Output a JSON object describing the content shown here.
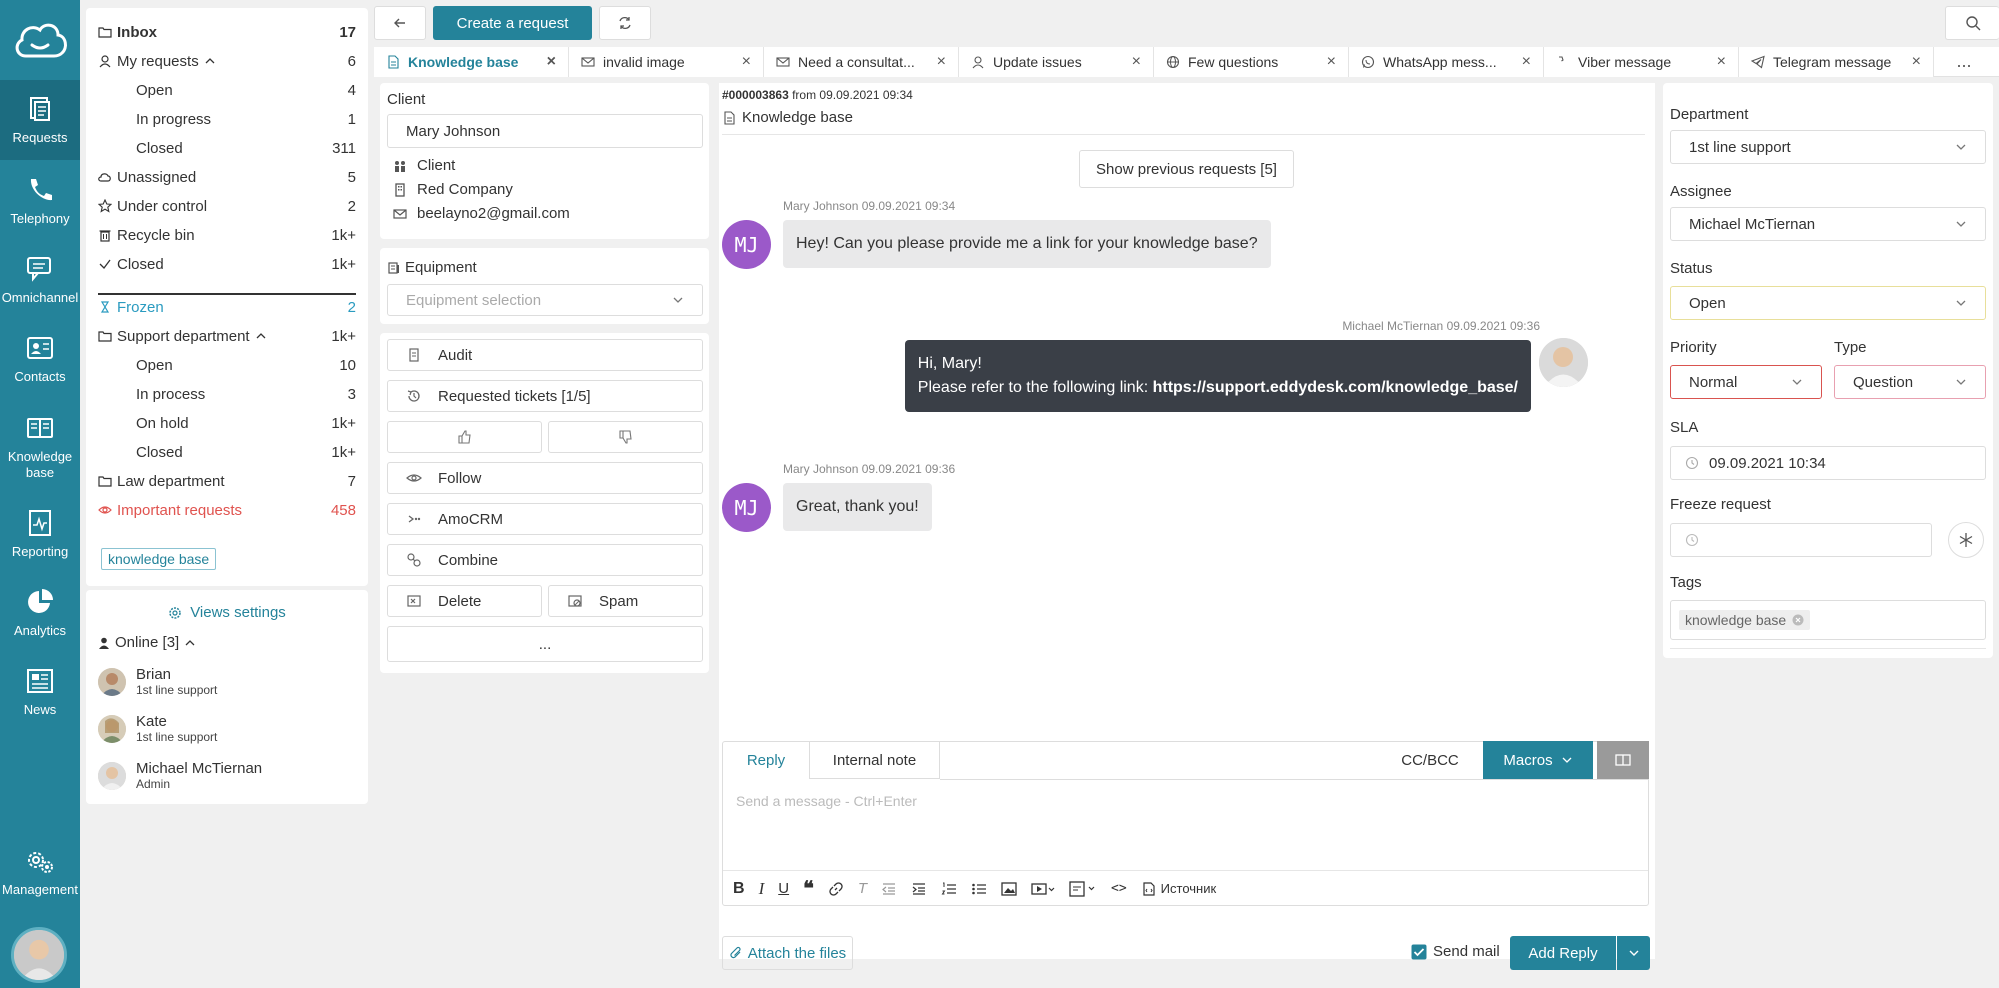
{
  "rail": {
    "items": [
      {
        "label": "Requests",
        "icon": "requests-icon"
      },
      {
        "label": "Telephony",
        "icon": "phone-icon"
      },
      {
        "label": "Omnichannel",
        "icon": "chat-icon"
      },
      {
        "label": "Contacts",
        "icon": "contacts-icon"
      },
      {
        "label": "Knowledge",
        "label2": "base",
        "icon": "book-icon"
      },
      {
        "label": "Reporting",
        "icon": "report-icon"
      },
      {
        "label": "Analytics",
        "icon": "pie-icon"
      },
      {
        "label": "News",
        "icon": "news-icon"
      },
      {
        "label": "Management",
        "icon": "gears-icon"
      }
    ]
  },
  "sidebar": {
    "inbox": {
      "label": "Inbox",
      "count": "17"
    },
    "my_requests": {
      "label": "My requests",
      "count": "6"
    },
    "open": {
      "label": "Open",
      "count": "4"
    },
    "in_progress": {
      "label": "In progress",
      "count": "1"
    },
    "closed": {
      "label": "Closed",
      "count": "311"
    },
    "unassigned": {
      "label": "Unassigned",
      "count": "5"
    },
    "under_control": {
      "label": "Under control",
      "count": "2"
    },
    "recycle": {
      "label": "Recycle bin",
      "count": "1k+"
    },
    "closed_all": {
      "label": "Closed",
      "count": "1k+"
    },
    "frozen": {
      "label": "Frozen",
      "count": "2"
    },
    "support": {
      "label": "Support department",
      "count": "1k+"
    },
    "s_open": {
      "label": "Open",
      "count": "10"
    },
    "s_process": {
      "label": "In process",
      "count": "3"
    },
    "s_hold": {
      "label": "On hold",
      "count": "1k+"
    },
    "s_closed": {
      "label": "Closed",
      "count": "1k+"
    },
    "law": {
      "label": "Law department",
      "count": "7"
    },
    "important": {
      "label": "Important requests",
      "count": "458"
    },
    "tag": "knowledge base"
  },
  "views": {
    "settings": "Views settings",
    "online": "Online [3]",
    "operators": [
      {
        "name": "Brian",
        "role": "1st line support"
      },
      {
        "name": "Kate",
        "role": "1st line support"
      },
      {
        "name": "Michael McTiernan",
        "role": "Admin"
      }
    ]
  },
  "toolbar": {
    "create": "Create a request"
  },
  "tabs": [
    {
      "label": "Knowledge base",
      "icon": "doc-icon"
    },
    {
      "label": "invalid image",
      "icon": "mail-icon"
    },
    {
      "label": "Need a consultat...",
      "icon": "mail-icon"
    },
    {
      "label": "Update issues",
      "icon": "user-icon"
    },
    {
      "label": "Few questions",
      "icon": "globe-icon"
    },
    {
      "label": "WhatsApp mess...",
      "icon": "whatsapp-icon"
    },
    {
      "label": "Viber message",
      "icon": "viber-icon"
    },
    {
      "label": "Telegram message",
      "icon": "telegram-icon"
    }
  ],
  "tabs_more": "...",
  "client": {
    "title": "Client",
    "name": "Mary Johnson",
    "type": "Client",
    "company": "Red Company",
    "email": "beelayno2@gmail.com"
  },
  "equipment": {
    "title": "Equipment",
    "placeholder": "Equipment selection"
  },
  "actions": {
    "audit": "Audit",
    "requested": "Requested tickets [1/5]",
    "follow": "Follow",
    "amocrm": "AmoCRM",
    "combine": "Combine",
    "delete": "Delete",
    "spam": "Spam",
    "more": "..."
  },
  "chat": {
    "id": "#000003863",
    "from": "from 09.09.2021 09:34",
    "subject": "Knowledge base",
    "show_prev": "Show previous requests [5]",
    "m1_meta": "Mary Johnson 09.09.2021 09:34",
    "m1_text": "Hey! Can you please provide me a link for your knowledge base?",
    "m2_meta": "Michael McTiernan 09.09.2021 09:36",
    "m2_line1": "Hi, Mary!",
    "m2_line2": "Please refer to the following link: ",
    "m2_link": "https://support.eddydesk.com/knowledge_base/",
    "m3_meta": "Mary Johnson 09.09.2021 09:36",
    "m3_text": "Great, thank you!",
    "initials": "MJ"
  },
  "editor": {
    "reply_tab": "Reply",
    "note_tab": "Internal note",
    "ccbcc": "CC/BCC",
    "macros": "Macros",
    "placeholder": "Send a message - Ctrl+Enter",
    "source": "Источник",
    "attach": "Attach the files",
    "send_mail": "Send mail",
    "add_reply": "Add Reply"
  },
  "props": {
    "department_lbl": "Department",
    "department": "1st line support",
    "assignee_lbl": "Assignee",
    "assignee": "Michael McTiernan",
    "status_lbl": "Status",
    "status": "Open",
    "priority_lbl": "Priority",
    "priority": "Normal",
    "type_lbl": "Type",
    "type": "Question",
    "sla_lbl": "SLA",
    "sla": "09.09.2021 10:34",
    "freeze_lbl": "Freeze request",
    "tags_lbl": "Tags",
    "tag": "knowledge base"
  },
  "colors": {
    "accent": "#24839a",
    "danger": "#e0534f",
    "frozen": "#2a9bc0",
    "status_border": "#e8df9a",
    "priority_border": "#d9534f",
    "type_border": "#e8a0b0"
  }
}
